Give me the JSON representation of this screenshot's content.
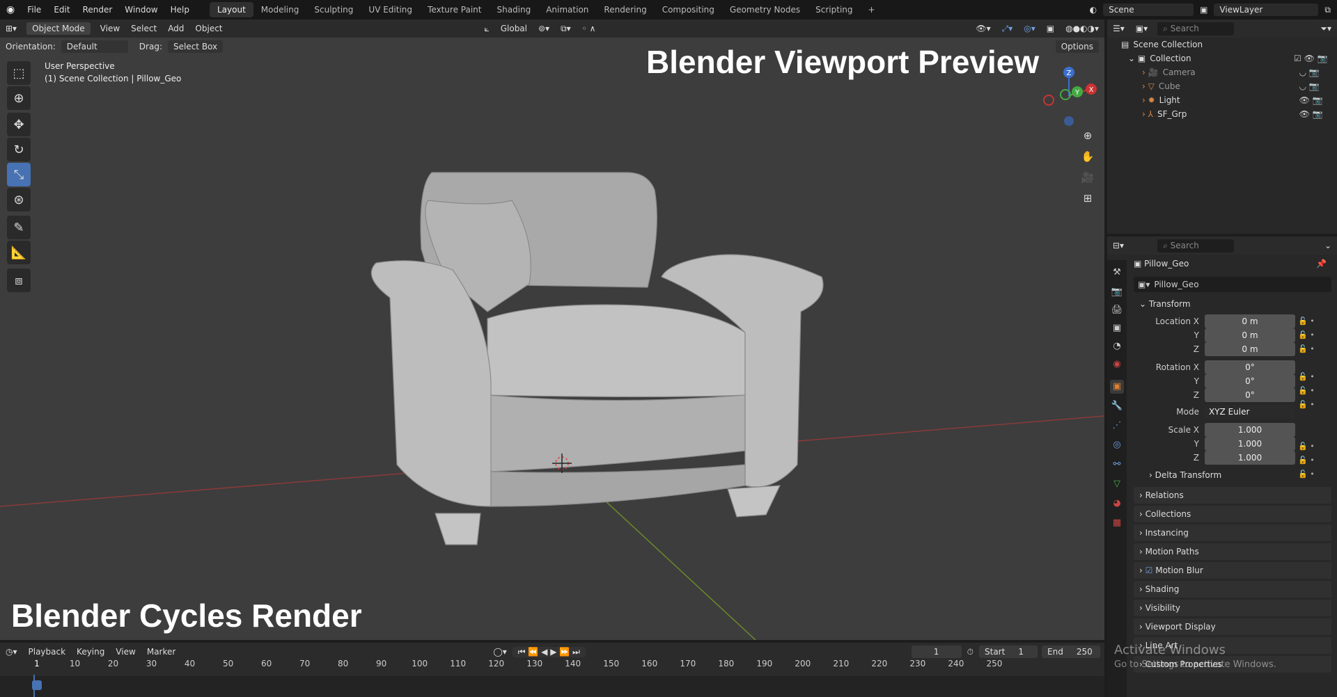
{
  "topbar": {
    "menus": [
      "File",
      "Edit",
      "Render",
      "Window",
      "Help"
    ],
    "workspaces": [
      "Layout",
      "Modeling",
      "Sculpting",
      "UV Editing",
      "Texture Paint",
      "Shading",
      "Animation",
      "Rendering",
      "Compositing",
      "Geometry Nodes",
      "Scripting"
    ],
    "active_workspace": "Layout",
    "plus": "+",
    "scene": "Scene",
    "view_layer": "ViewLayer"
  },
  "viewport": {
    "mode": "Object Mode",
    "menus": [
      "View",
      "Select",
      "Add",
      "Object"
    ],
    "orientation_label": "Orientation:",
    "orientation_value": "Default",
    "drag_label": "Drag:",
    "drag_value": "Select Box",
    "transform_space": "Global",
    "options": "Options",
    "perspective": "User Perspective",
    "collection_info": "(1) Scene Collection | Pillow_Geo",
    "overlay_title": "Blender Viewport Preview",
    "overlay_bottom": "Blender Cycles Render",
    "gizmo": {
      "x": "X",
      "y": "Y",
      "z": "Z"
    }
  },
  "outliner": {
    "search_placeholder": "Search",
    "scene_collection": "Scene Collection",
    "collection": "Collection",
    "items": [
      "Camera",
      "Cube",
      "Light",
      "SF_Grp"
    ]
  },
  "properties": {
    "search_placeholder": "Search",
    "object_name": "Pillow_Geo",
    "data_name": "Pillow_Geo",
    "transform_label": "Transform",
    "location": {
      "label": "Location X",
      "x": "0 m",
      "y": "0 m",
      "z": "0 m"
    },
    "rotation": {
      "label": "Rotation X",
      "x": "0°",
      "y": "0°",
      "z": "0°"
    },
    "mode_label": "Mode",
    "mode_value": "XYZ Euler",
    "scale": {
      "label": "Scale X",
      "x": "1.000",
      "y": "1.000",
      "z": "1.000"
    },
    "axis_y": "Y",
    "axis_z": "Z",
    "delta": "Delta Transform",
    "sections": [
      "Relations",
      "Collections",
      "Instancing",
      "Motion Paths",
      "Motion Blur",
      "Shading",
      "Visibility",
      "Viewport Display",
      "Line Art",
      "Custom Properties"
    ],
    "watermark_title": "Activate Windows",
    "watermark_sub": "Go to Settings to activate Windows."
  },
  "timeline": {
    "menus": [
      "Playback",
      "Keying",
      "View",
      "Marker"
    ],
    "current_frame": "1",
    "start_label": "Start",
    "start": "1",
    "end_label": "End",
    "end": "250",
    "ticks": [
      "1",
      "10",
      "20",
      "30",
      "40",
      "50",
      "60",
      "70",
      "80",
      "90",
      "100",
      "110",
      "120",
      "130",
      "140",
      "150",
      "160",
      "170",
      "180",
      "190",
      "200",
      "210",
      "220",
      "230",
      "240",
      "250"
    ]
  }
}
